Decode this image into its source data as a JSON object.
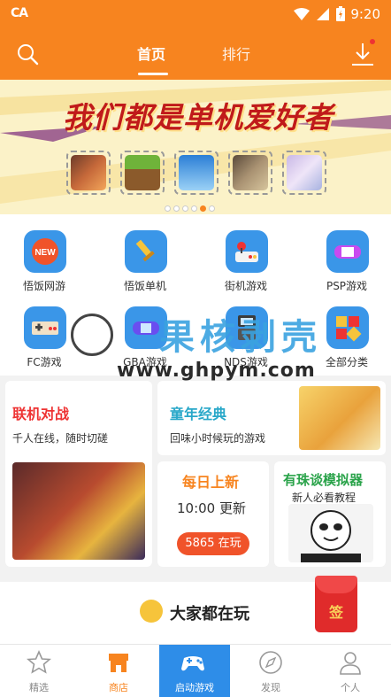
{
  "status": {
    "carrier_glyph": "CA",
    "time": "9:20"
  },
  "header": {
    "tabs": [
      "首页",
      "排行"
    ]
  },
  "banner": {
    "headline": "我们都是单机爱好者"
  },
  "categories": [
    {
      "label": "悟饭网游",
      "badge": "NEW"
    },
    {
      "label": "悟饭单机"
    },
    {
      "label": "街机游戏"
    },
    {
      "label": "PSP游戏"
    },
    {
      "label": "FC游戏"
    },
    {
      "label": "GBA游戏"
    },
    {
      "label": "NDS游戏"
    },
    {
      "label": "全部分类"
    }
  ],
  "watermark": {
    "cn": "果核剥壳",
    "url": "www.ghpym.com"
  },
  "cards": {
    "multiplayer": {
      "title": "联机对战",
      "subtitle": "千人在线，随时切磋"
    },
    "classic": {
      "title": "童年经典",
      "subtitle": "回味小时候玩的游戏"
    },
    "daily": {
      "title": "每日上新",
      "time": "10:00 更新",
      "playing": "5865 在玩"
    },
    "emulator": {
      "title": "有珠谈模拟器",
      "subtitle": "新人必看教程"
    }
  },
  "popular": {
    "title": "大家都在玩"
  },
  "sign": {
    "label": "签"
  },
  "bottom_nav": [
    "精选",
    "商店",
    "启动游戏",
    "发现",
    "个人"
  ],
  "colors": {
    "accent": "#f7841f",
    "blue": "#2e8de8",
    "red": "#e02b2b"
  }
}
